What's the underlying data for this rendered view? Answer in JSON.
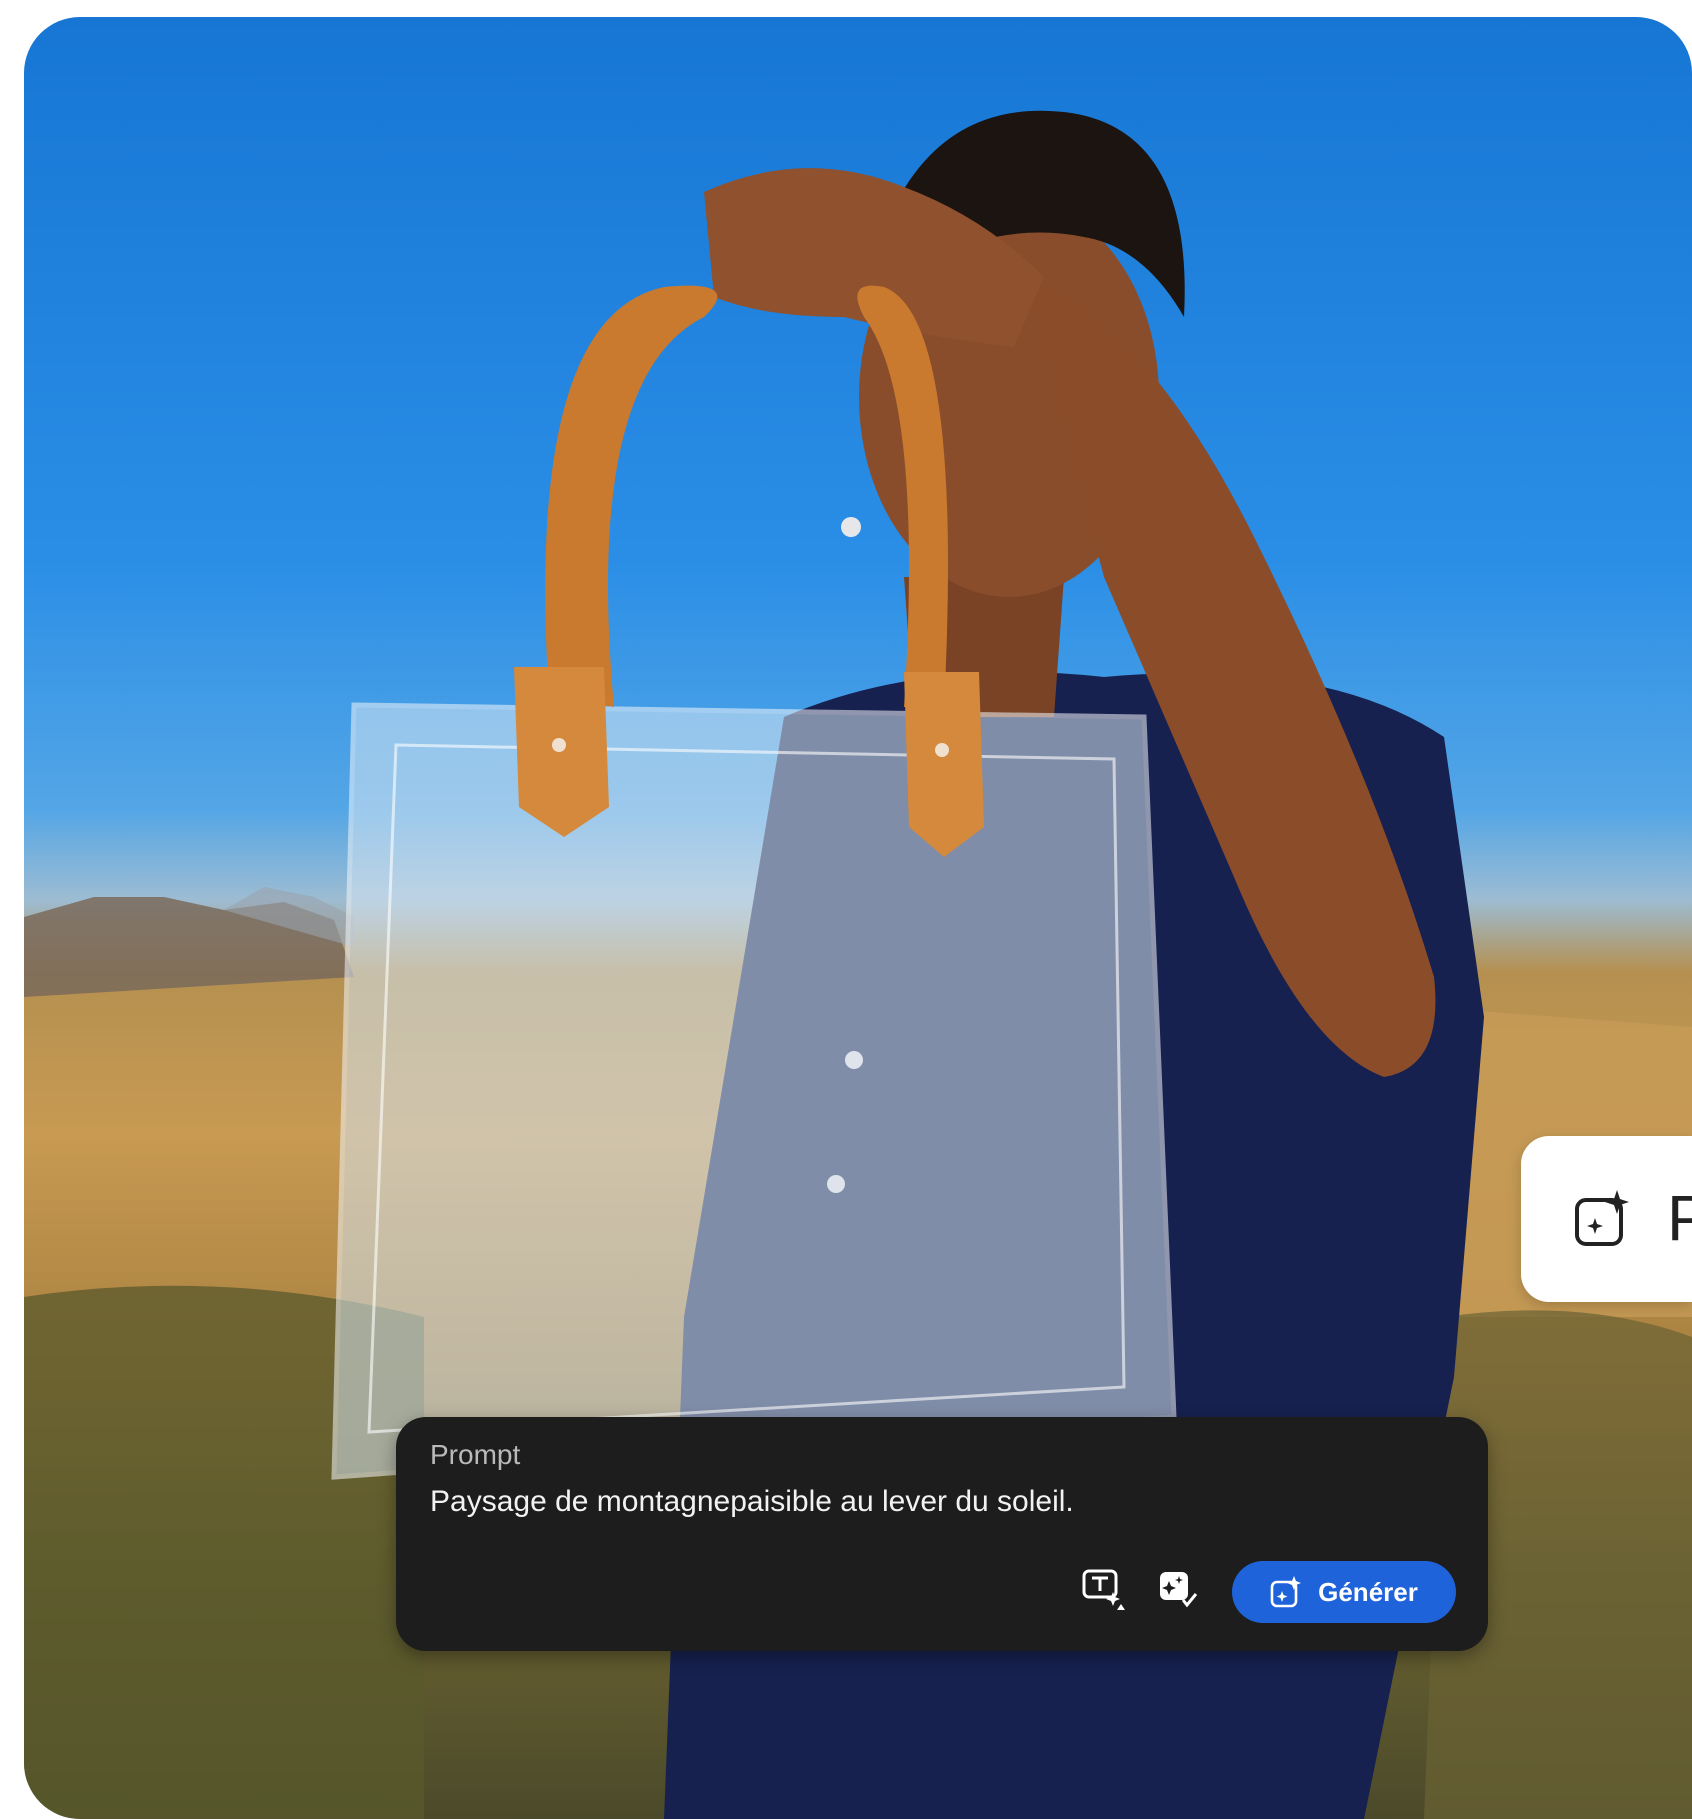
{
  "photo": {
    "subject": "hero-photo-person-holding-clear-bag"
  },
  "side_chip": {
    "icon": "generative-sparkle-icon",
    "label": "P"
  },
  "prompt_panel": {
    "label": "Prompt",
    "text": "Paysage de montagnepaisible au lever du soleil.",
    "tools": [
      {
        "icon": "text-effects-icon"
      },
      {
        "icon": "image-check-icon"
      }
    ],
    "generate": {
      "icon": "generative-sparkle-icon",
      "label": "Générer"
    }
  },
  "colors": {
    "panel_bg": "#1d1d1d",
    "accent": "#1e63d9",
    "sky": "#1776d4"
  }
}
